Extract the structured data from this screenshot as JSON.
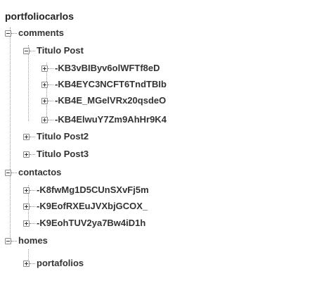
{
  "tree": {
    "root": "portfoliocarlos",
    "comments": {
      "label": "comments",
      "titulo_post": {
        "label": "Titulo Post",
        "keys": [
          "-KB3vBIByv6olWFTf8eD",
          "-KB4EYC3NCFT6TndTBIb",
          "-KB4E_MGelVRx20qsdeO",
          "-KB4ElwuY7Zm9AhHr9K4"
        ]
      },
      "titulo_post2": "Titulo Post2",
      "titulo_post3": "Titulo Post3"
    },
    "contactos": {
      "label": "contactos",
      "keys": [
        "-K8fwMg1D5CUnSXvFj5m",
        "-K9EofRXEuJVXbjGCOX_",
        "-K9EohTUV2ya7Bw4iD1h"
      ]
    },
    "homes": {
      "label": "homes",
      "children": [
        "portafolios"
      ]
    }
  }
}
